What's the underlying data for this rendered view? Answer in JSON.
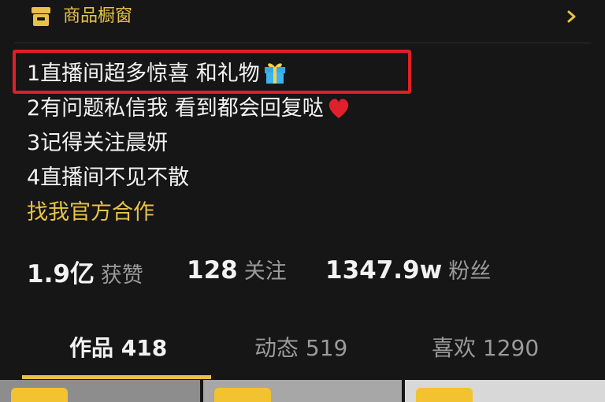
{
  "shop": {
    "label": "商品橱窗",
    "icon": "shop-icon",
    "accent": "#e8c248"
  },
  "bio": {
    "lines": [
      {
        "text": "1直播间超多惊喜 和礼物",
        "emoji": "gift"
      },
      {
        "text": "2有问题私信我 看到都会回复哒",
        "emoji": "heart"
      },
      {
        "text": "3记得关注晨妍"
      },
      {
        "text": "4直播间不见不散"
      }
    ],
    "link": "找我官方合作"
  },
  "annotation_color": "#e01f27",
  "stats": [
    {
      "value": "1.9亿",
      "label": "获赞"
    },
    {
      "value": "128",
      "label": "关注"
    },
    {
      "value": "1347.9w",
      "label": "粉丝"
    }
  ],
  "tabs": [
    {
      "label": "作品 418",
      "active": true
    },
    {
      "label": "动态 519",
      "active": false
    },
    {
      "label": "喜欢 1290",
      "active": false
    }
  ]
}
